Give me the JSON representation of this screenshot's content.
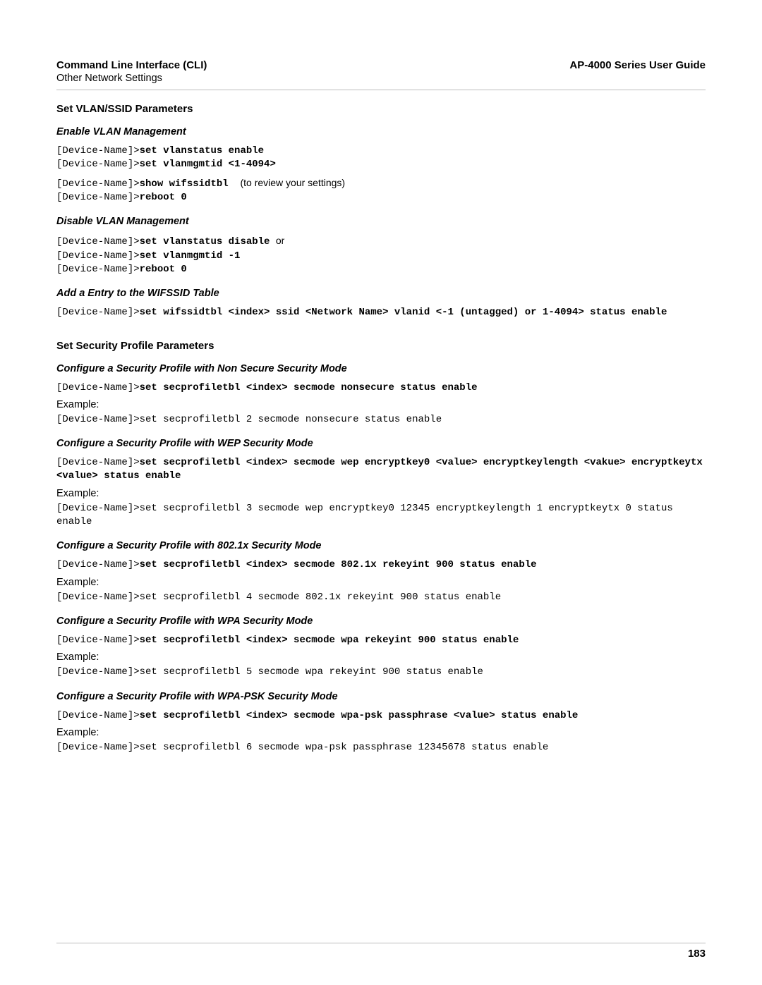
{
  "header": {
    "left_title": "Command Line Interface (CLI)",
    "left_sub": "Other Network Settings",
    "right_title": "AP-4000 Series User Guide"
  },
  "vlan": {
    "section_title": "Set VLAN/SSID Parameters",
    "enable": {
      "heading": "Enable VLAN Management",
      "l1_prompt": "[Device-Name]>",
      "l1_cmd": "set vlanstatus enable",
      "l2_prompt": "[Device-Name]>",
      "l2_cmd": "set vlanmgmtid <1-4094>",
      "l3_prompt": "[Device-Name]>",
      "l3_cmd": "show wifssidtbl",
      "l3_note": "(to review your settings)",
      "l4_prompt": "[Device-Name]>",
      "l4_cmd": "reboot 0"
    },
    "disable": {
      "heading": "Disable VLAN Management",
      "l1_prompt": "[Device-Name]>",
      "l1_cmd": "set vlanstatus disable",
      "l1_or": "or",
      "l2_prompt": "[Device-Name]>",
      "l2_cmd": "set vlanmgmtid -1",
      "l3_prompt": "[Device-Name]>",
      "l3_cmd": "reboot 0"
    },
    "add_entry": {
      "heading": "Add a Entry to the WIFSSID Table",
      "l1_prompt": "[Device-Name]>",
      "l1_cmd": "set wifssidtbl <index> ssid <Network Name> vlanid <-1 (untagged) or 1-4094> status enable"
    }
  },
  "sec": {
    "section_title": "Set Security Profile Parameters",
    "example_label": "Example:",
    "nonsecure": {
      "heading": "Configure a Security Profile with Non Secure Security Mode",
      "prompt": "[Device-Name]>",
      "cmd": "set secprofiletbl <index> secmode nonsecure status enable",
      "example": "[Device-Name]>set secprofiletbl 2 secmode nonsecure status enable"
    },
    "wep": {
      "heading": "Configure a Security Profile with WEP Security Mode",
      "prompt": "[Device-Name]>",
      "cmd": "set secprofiletbl <index> secmode wep encryptkey0 <value> encryptkeylength <vakue> encryptkeytx <value> status enable",
      "example": "[Device-Name]>set secprofiletbl 3 secmode wep encryptkey0 12345 encryptkeylength 1 encryptkeytx 0 status enable"
    },
    "dot1x": {
      "heading": "Configure a Security Profile with 802.1x Security Mode",
      "prompt": "[Device-Name]>",
      "cmd": "set secprofiletbl <index> secmode 802.1x rekeyint 900 status enable",
      "example": "[Device-Name]>set secprofiletbl 4 secmode 802.1x rekeyint 900 status enable"
    },
    "wpa": {
      "heading": "Configure a Security Profile with WPA Security Mode",
      "prompt": "[Device-Name]>",
      "cmd": "set secprofiletbl <index> secmode wpa rekeyint 900 status enable",
      "example": "[Device-Name]>set secprofiletbl 5 secmode wpa rekeyint 900 status enable"
    },
    "wpapsk": {
      "heading": "Configure a Security Profile with WPA-PSK Security Mode",
      "prompt": "[Device-Name]>",
      "cmd": "set secprofiletbl <index> secmode wpa-psk passphrase <value> status enable",
      "example": "[Device-Name]>set secprofiletbl 6 secmode wpa-psk passphrase 12345678 status enable"
    }
  },
  "footer": {
    "page": "183"
  }
}
